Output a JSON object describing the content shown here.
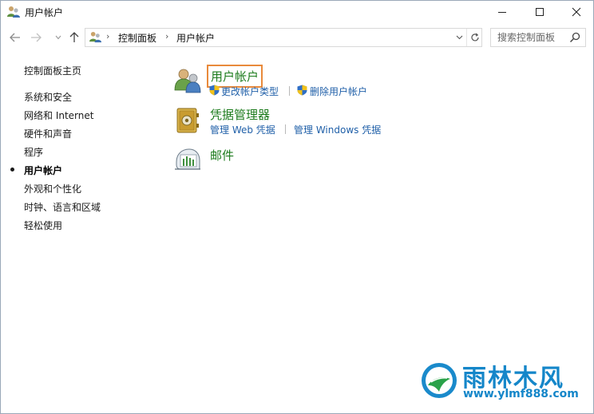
{
  "window": {
    "title": "用户帐户"
  },
  "address": {
    "crumbs": [
      "控制面板",
      "用户帐户"
    ]
  },
  "search": {
    "placeholder": "搜索控制面板"
  },
  "sidebar": {
    "home": "控制面板主页",
    "items": [
      {
        "label": "系统和安全"
      },
      {
        "label": "网络和 Internet"
      },
      {
        "label": "硬件和声音"
      },
      {
        "label": "程序"
      },
      {
        "label": "用户帐户",
        "current": true
      },
      {
        "label": "外观和个性化"
      },
      {
        "label": "时钟、语言和区域"
      },
      {
        "label": "轻松使用"
      }
    ]
  },
  "categories": [
    {
      "title": "用户帐户",
      "icon": "user-accounts-icon",
      "highlighted": true,
      "links": [
        "更改帐户类型",
        "删除用户帐户"
      ]
    },
    {
      "title": "凭据管理器",
      "icon": "credential-vault-icon",
      "links": [
        "管理 Web 凭据",
        "管理 Windows 凭据"
      ]
    },
    {
      "title": "邮件",
      "icon": "mail-icon",
      "links": []
    }
  ],
  "watermark": {
    "brand": "雨林木风",
    "url": "www.ylmf888.com"
  },
  "colors": {
    "category_title": "#1e7c1e",
    "link": "#1f5fa8",
    "highlight_box": "#e98a3b",
    "watermark": "#1486c9"
  }
}
